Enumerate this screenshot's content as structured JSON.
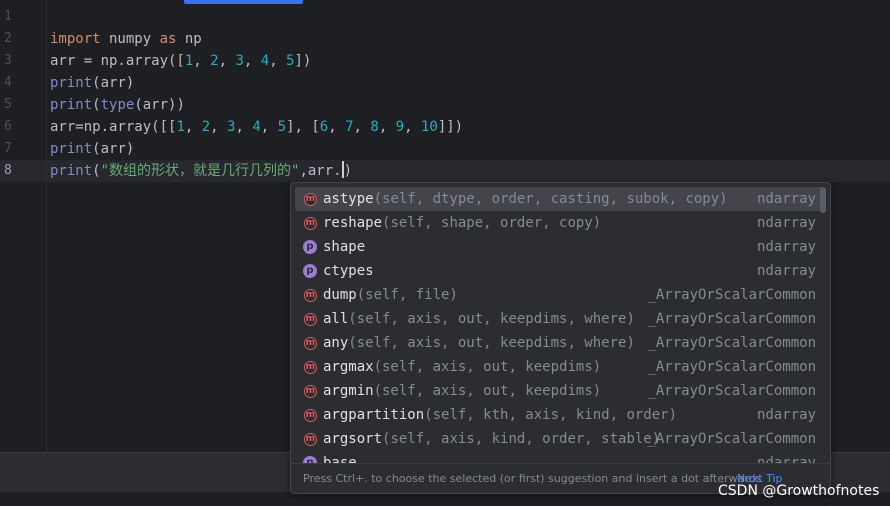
{
  "editor": {
    "line_numbers": [
      "1",
      "2",
      "3",
      "4",
      "5",
      "6",
      "7",
      "8"
    ],
    "lines": [
      {
        "kw1": "import",
        "t1": " numpy ",
        "kw2": "as",
        "t2": " np"
      },
      {
        "t1": "arr = np.array([",
        "n1": "1",
        "t2": ", ",
        "n2": "2",
        "t3": ", ",
        "n3": "3",
        "t4": ", ",
        "n4": "4",
        "t5": ", ",
        "n5": "5",
        "t6": "])"
      },
      {
        "f1": "print",
        "t1": "(arr)"
      },
      {
        "f1": "print",
        "t1": "(",
        "f2": "type",
        "t2": "(arr))"
      },
      {
        "t1": "arr=np.array([[",
        "n1": "1",
        "t2": ", ",
        "n2": "2",
        "t3": ", ",
        "n3": "3",
        "t4": ", ",
        "n4": "4",
        "t5": ", ",
        "n5": "5",
        "t6": "], [",
        "n6": "6",
        "t7": ", ",
        "n7": "7",
        "t8": ", ",
        "n8": "8",
        "t9": ", ",
        "n9": "9",
        "t10": ", ",
        "n10": "10",
        "t11": "]])"
      },
      {
        "f1": "print",
        "t1": "(arr)"
      },
      {
        "f1": "print",
        "t1": "(",
        "s1": "\"数组的形状，就是几行几列的\"",
        "t2": ",arr.",
        "t3": ")"
      }
    ]
  },
  "completion": {
    "items": [
      {
        "icon": "m",
        "name": "astype",
        "params": "(self, dtype, order, casting, subok, copy)",
        "type": "ndarray"
      },
      {
        "icon": "m",
        "name": "reshape",
        "params": "(self, shape, order, copy)",
        "type": "ndarray"
      },
      {
        "icon": "p",
        "name": "shape",
        "params": "",
        "type": "ndarray"
      },
      {
        "icon": "p",
        "name": "ctypes",
        "params": "",
        "type": "ndarray"
      },
      {
        "icon": "m",
        "name": "dump",
        "params": "(self, file)",
        "type": "_ArrayOrScalarCommon"
      },
      {
        "icon": "m",
        "name": "all",
        "params": "(self, axis, out, keepdims, where)",
        "type": "_ArrayOrScalarCommon"
      },
      {
        "icon": "m",
        "name": "any",
        "params": "(self, axis, out, keepdims, where)",
        "type": "_ArrayOrScalarCommon"
      },
      {
        "icon": "m",
        "name": "argmax",
        "params": "(self, axis, out, keepdims)",
        "type": "_ArrayOrScalarCommon"
      },
      {
        "icon": "m",
        "name": "argmin",
        "params": "(self, axis, out, keepdims)",
        "type": "_ArrayOrScalarCommon"
      },
      {
        "icon": "m",
        "name": "argpartition",
        "params": "(self, kth, axis, kind, order)",
        "type": "ndarray"
      },
      {
        "icon": "m",
        "name": "argsort",
        "params": "(self, axis, kind, order, stable)",
        "type": "_ArrayOrScalarCommon"
      },
      {
        "icon": "p",
        "name": "base",
        "params": "",
        "type": "ndarray"
      }
    ],
    "footer_text": "Press Ctrl+. to choose the selected (or first) suggestion and insert a dot afterwards",
    "footer_link": "Next Tip"
  },
  "watermark": "CSDN @Growthofnotes",
  "colors": {
    "accent": "#3574f0",
    "method_icon": "#db5c5c",
    "property_icon": "#9b7dd4"
  }
}
